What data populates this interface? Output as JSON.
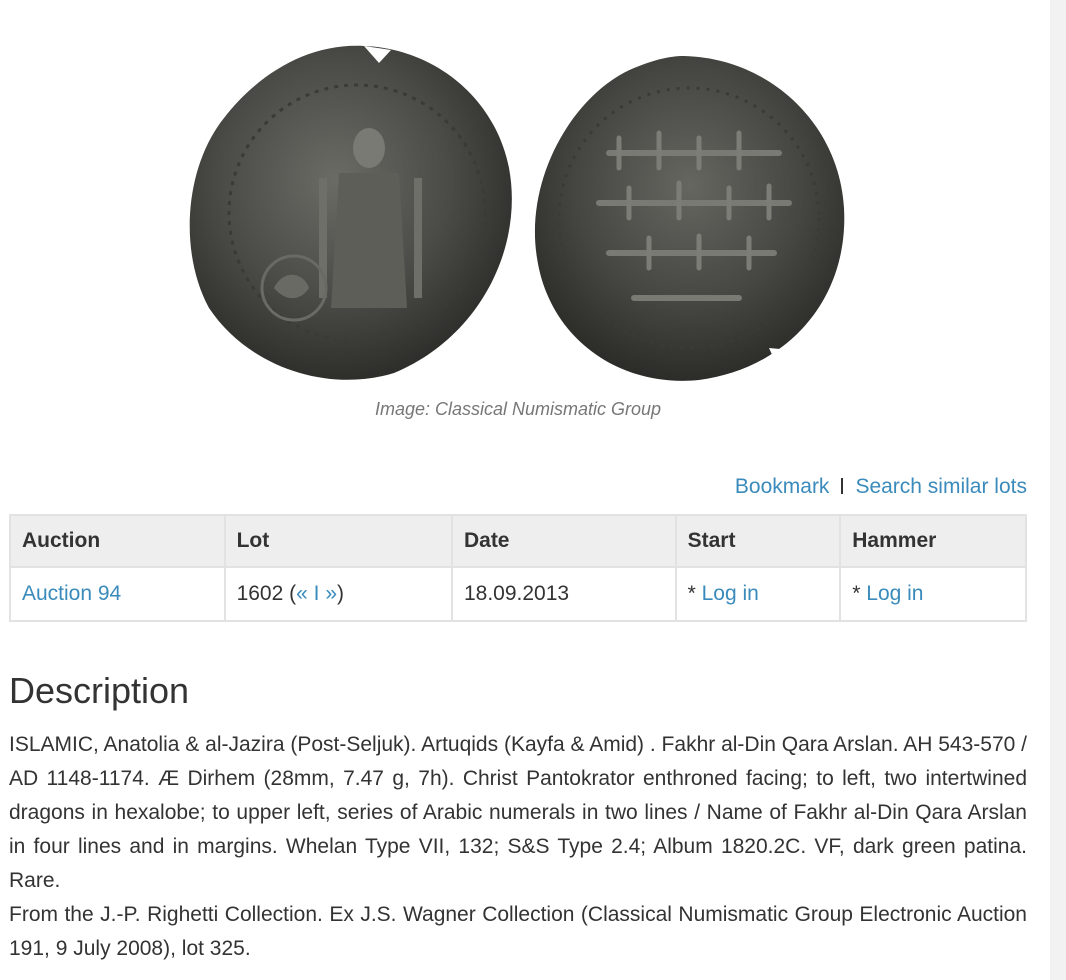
{
  "image": {
    "caption": "Image: Classical Numismatic Group"
  },
  "actions": {
    "bookmark": "Bookmark",
    "search_similar": "Search similar lots"
  },
  "table": {
    "headers": {
      "auction": "Auction",
      "lot": "Lot",
      "date": "Date",
      "start": "Start",
      "hammer": "Hammer"
    },
    "row": {
      "auction": "Auction 94",
      "lot_number": "1602 (",
      "prev": "«",
      "pipe": "I",
      "next": "»",
      "lot_close": ")",
      "date": "18.09.2013",
      "start_prefix": "* ",
      "start_link": "Log in",
      "hammer_prefix": "* ",
      "hammer_link": "Log in"
    }
  },
  "description": {
    "heading": "Description",
    "paragraph1": "ISLAMIC, Anatolia & al-Jazira (Post-Seljuk). Artuqids (Kayfa & Amid) . Fakhr al-Din Qara Arslan. AH 543-570 / AD 1148-1174. Æ Dirhem (28mm, 7.47 g, 7h). Christ Pantokrator enthroned facing; to left, two intertwined dragons in hexalobe; to upper left, series of Arabic numerals in two lines / Name of Fakhr al-Din Qara Arslan in four lines and in margins. Whelan Type VII, 132; S&S Type 2.4; Album 1820.2C. VF, dark green patina. Rare.",
    "paragraph2": "From the J.-P. Righetti Collection. Ex J.S. Wagner Collection (Classical Numismatic Group Electronic Auction 191, 9 July 2008), lot 325."
  },
  "colors": {
    "link": "#3a8bbb",
    "text": "#333333",
    "caption": "#777777",
    "table_header_bg": "#eeeeee",
    "table_border": "#e2e2e2"
  }
}
